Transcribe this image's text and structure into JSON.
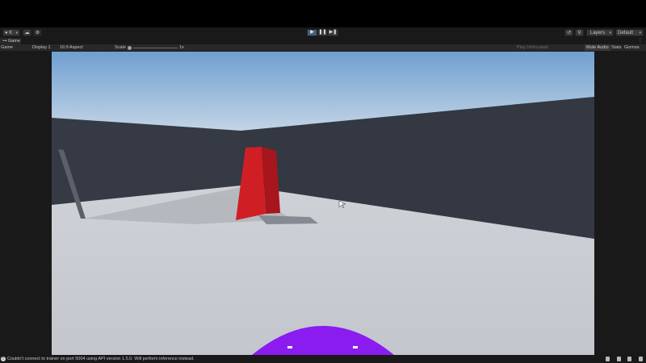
{
  "toolbar": {
    "account_label": "K",
    "play_icon": "play-icon",
    "pause_icon": "pause-icon",
    "step_icon": "step-icon",
    "layers_label": "Layers",
    "layout_label": "Default"
  },
  "tabs": {
    "game_tab": "Game"
  },
  "game_toolbar": {
    "mode": "Game",
    "display": "Display 1",
    "aspect": "16:9 Aspect",
    "scale_label": "Scale",
    "scale_value": "1x",
    "play_focused_placeholder": "Play Unfocused",
    "mute_audio": "Mute Audio",
    "stats": "Stats",
    "gizmos": "Gizmos"
  },
  "status": {
    "message": "Couldn't connect to trainer on port 5004 using API version 1.5.0. Will perform inference instead."
  },
  "colors": {
    "editor_bg": "#191919",
    "sky_top": "#6f9fd1",
    "sky_bottom": "#cddbe8",
    "floor": "#c8ccd2",
    "wall": "#333843",
    "cube": "#cc1d24",
    "agent": "#8a1cf0",
    "accent_play": "#46607c"
  }
}
